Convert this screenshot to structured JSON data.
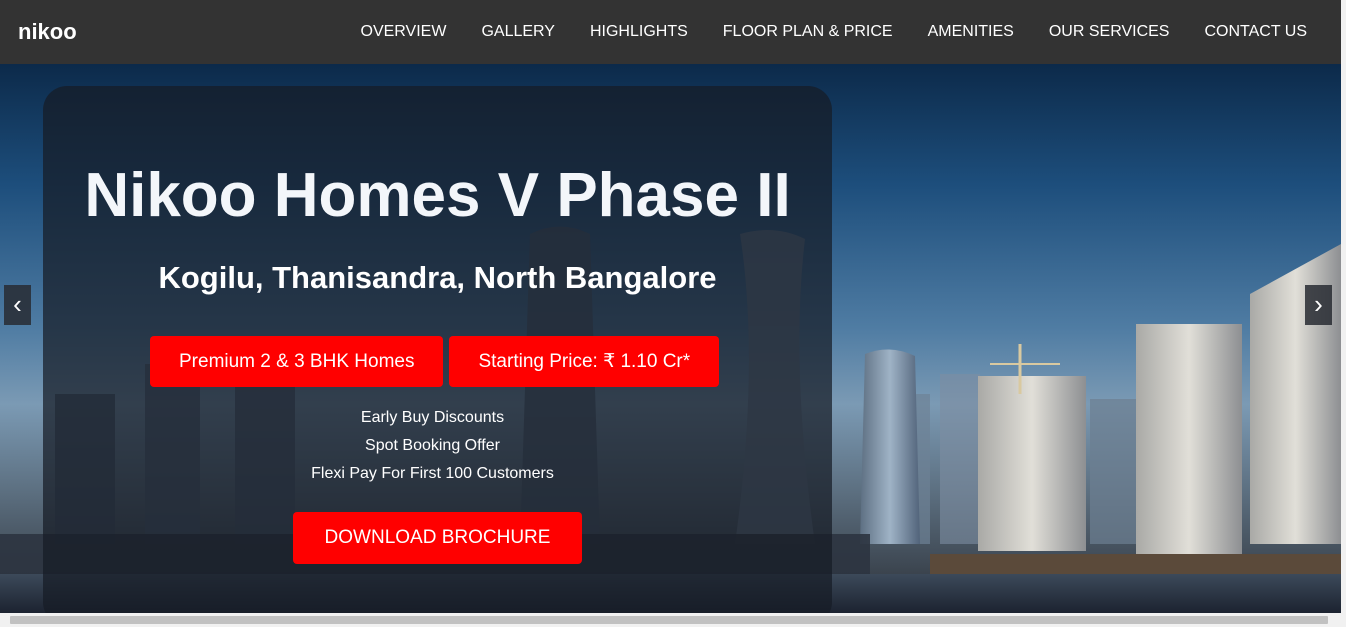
{
  "nav": {
    "brand": "nikoo",
    "links": [
      {
        "label": "OVERVIEW"
      },
      {
        "label": "GALLERY"
      },
      {
        "label": "HIGHLIGHTS"
      },
      {
        "label": "FLOOR PLAN & PRICE"
      },
      {
        "label": "AMENITIES"
      },
      {
        "label": "OUR SERVICES"
      },
      {
        "label": "CONTACT US"
      }
    ]
  },
  "hero": {
    "title": "Nikoo Homes V Phase II",
    "subtitle": "Kogilu, Thanisandra, North Bangalore",
    "pills": [
      {
        "label": "Premium 2 & 3 BHK Homes"
      },
      {
        "label": "Starting Price: ₹ 1.10 Cr*"
      }
    ],
    "offers": [
      {
        "text": "Early Buy Discounts"
      },
      {
        "text": "Spot Booking Offer"
      },
      {
        "text": "Flexi Pay For First 100 Customers"
      }
    ],
    "cta_label": "DOWNLOAD BROCHURE",
    "prev_arrow": "‹",
    "next_arrow": "›"
  },
  "colors": {
    "navbar": "#333333",
    "accent": "#ff0000"
  }
}
